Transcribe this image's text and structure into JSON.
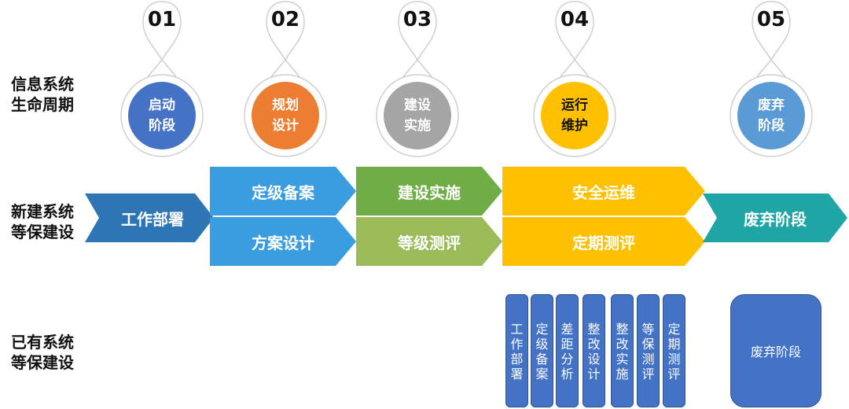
{
  "row_labels": {
    "lifecycle": [
      "信息系统",
      "生命周期"
    ],
    "new_system": [
      "新建系统",
      "等保建设"
    ],
    "existing_system": [
      "已有系统",
      "等保建设"
    ]
  },
  "lifecycle_stages": [
    {
      "num": "01",
      "line1": "启动",
      "line2": "阶段",
      "color": "#4472c4"
    },
    {
      "num": "02",
      "line1": "规划",
      "line2": "设计",
      "color": "#ed7d31"
    },
    {
      "num": "03",
      "line1": "建设",
      "line2": "实施",
      "color": "#a5a5a5"
    },
    {
      "num": "04",
      "line1": "运行",
      "line2": "维护",
      "color": "#ffc000"
    },
    {
      "num": "05",
      "line1": "废弃",
      "line2": "阶段",
      "color": "#5b9bd5"
    }
  ],
  "new_system_steps": {
    "work_deploy": "工作部署",
    "grading_filing": "定级备案",
    "plan_design": "方案设计",
    "build_implement": "建设实施",
    "level_evaluation": "等级测评",
    "security_ops": "安全运维",
    "periodic_evaluation": "定期测评",
    "decommission": "废弃阶段"
  },
  "existing_system_steps": [
    [
      "工",
      "作",
      "部",
      "署"
    ],
    [
      "定",
      "级",
      "备",
      "案"
    ],
    [
      "差",
      "距",
      "分",
      "析"
    ],
    [
      "整",
      "改",
      "设",
      "计"
    ],
    [
      "整",
      "改",
      "实",
      "施"
    ],
    [
      "等",
      "保",
      "测",
      "评"
    ],
    [
      "定",
      "期",
      "测",
      "评"
    ]
  ],
  "existing_decommission": "废弃阶段",
  "colors": {
    "dark_blue": "#2e75b6",
    "light_blue": "#3a9de0",
    "dark_green": "#70ad47",
    "light_green": "#9bbb59",
    "yellow": "#ffc000",
    "teal": "#1fa5a5",
    "bar_blue": "#4472c4"
  }
}
